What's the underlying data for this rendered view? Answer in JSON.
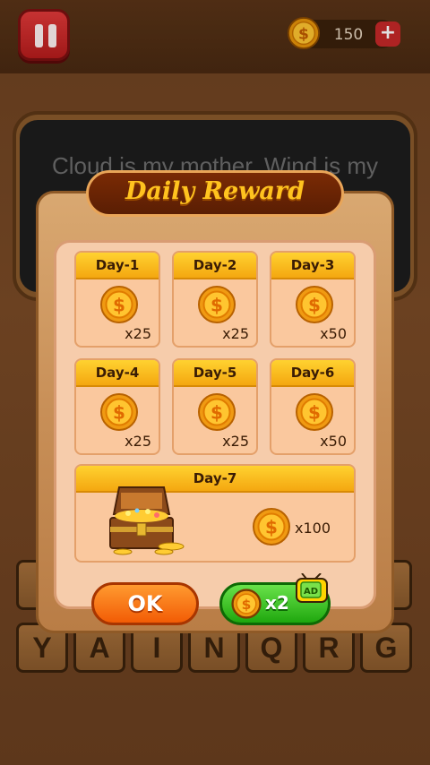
{
  "topbar": {
    "coins": "150",
    "plus_label": "+"
  },
  "clue_text": "Cloud is my mother. Wind is my",
  "keyboard_rows": [
    [
      "",
      "",
      "",
      "",
      "",
      "",
      ""
    ],
    [
      "Y",
      "A",
      "I",
      "N",
      "Q",
      "R",
      "G"
    ]
  ],
  "dialog": {
    "title": "Daily Reward",
    "days": [
      {
        "label": "Day-1",
        "amount": "x25"
      },
      {
        "label": "Day-2",
        "amount": "x25"
      },
      {
        "label": "Day-3",
        "amount": "x50"
      },
      {
        "label": "Day-4",
        "amount": "x25"
      },
      {
        "label": "Day-5",
        "amount": "x25"
      },
      {
        "label": "Day-6",
        "amount": "x50"
      }
    ],
    "day7": {
      "label": "Day-7",
      "amount": "x100"
    },
    "ok_label": "OK",
    "double_label": "x2",
    "ad_label": "AD"
  },
  "colors": {
    "coin_gold": "#ffb41c",
    "title_gold": "#ffc31f",
    "ok_orange": "#f25c05",
    "double_green": "#1fa70e"
  }
}
